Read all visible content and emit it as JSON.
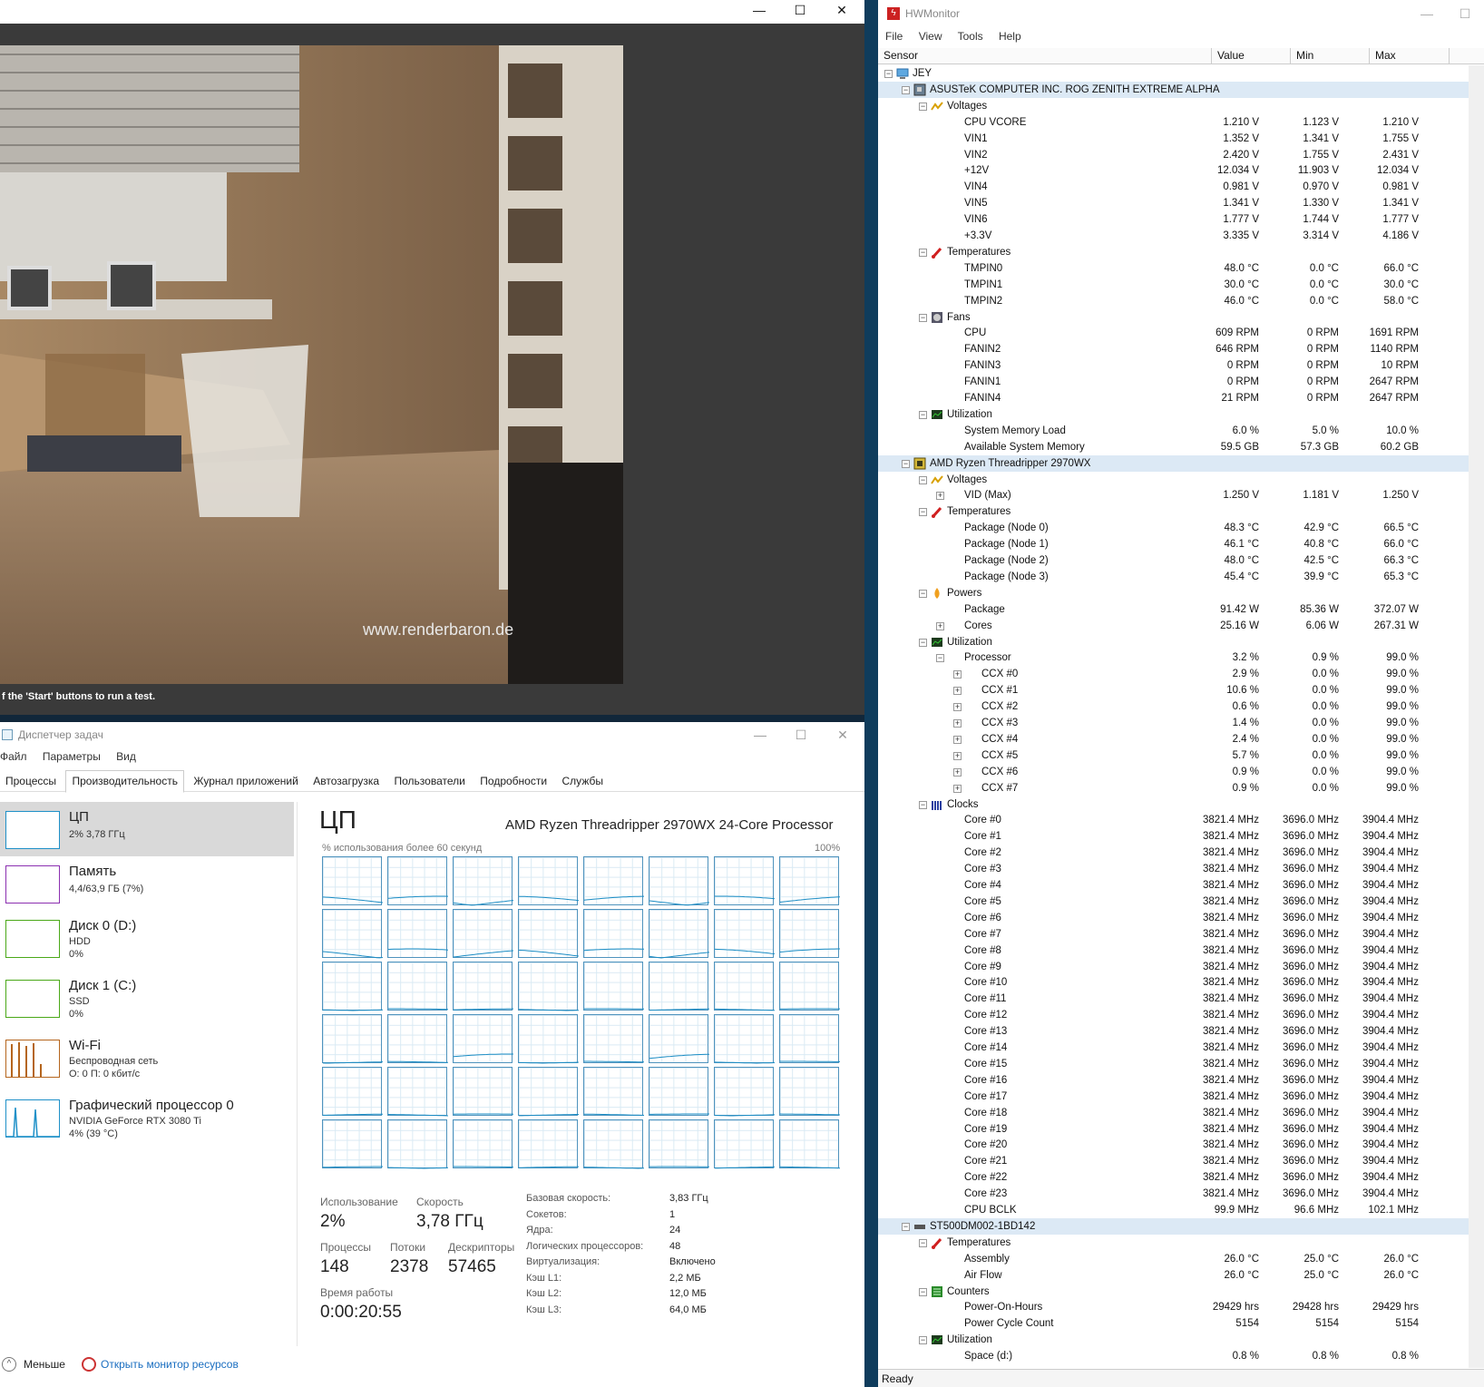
{
  "render_window": {
    "minimize": "—",
    "maximize": "☐",
    "close": "✕",
    "status": "f the 'Start' buttons to run a test.",
    "watermark": "www.renderbaron.de"
  },
  "task_manager": {
    "title": "Диспетчер задач",
    "menu": [
      "Файл",
      "Параметры",
      "Вид"
    ],
    "tabs": [
      "Процессы",
      "Производительность",
      "Журнал приложений",
      "Автозагрузка",
      "Пользователи",
      "Подробности",
      "Службы"
    ],
    "active_tab": 1,
    "sidebar": [
      {
        "title": "ЦП",
        "sub1": "2% 3,78 ГГц",
        "sub2": "",
        "color": "#1e90c8"
      },
      {
        "title": "Память",
        "sub1": "4,4/63,9 ГБ (7%)",
        "sub2": "",
        "color": "#8b2fb0"
      },
      {
        "title": "Диск 0 (D:)",
        "sub1": "HDD",
        "sub2": "0%",
        "color": "#4aa818"
      },
      {
        "title": "Диск 1 (C:)",
        "sub1": "SSD",
        "sub2": "0%",
        "color": "#4aa818"
      },
      {
        "title": "Wi-Fi",
        "sub1": "Беспроводная сеть",
        "sub2": "О: 0 П: 0 кбит/с",
        "color": "#b5651d"
      },
      {
        "title": "Графический процессор 0",
        "sub1": "NVIDIA GeForce RTX 3080 Ti",
        "sub2": "4% (39 °C)",
        "color": "#1e90c8"
      }
    ],
    "main": {
      "title": "ЦП",
      "processor": "AMD Ryzen Threadripper 2970WX 24-Core Processor",
      "graph_label": "% использования более 60 секунд",
      "graph_max": "100%",
      "usage_label": "Использование",
      "usage": "2%",
      "speed_label": "Скорость",
      "speed": "3,78 ГГц",
      "proc_label": "Процессы",
      "proc": "148",
      "threads_label": "Потоки",
      "threads": "2378",
      "handles_label": "Дескрипторы",
      "handles": "57465",
      "uptime_label": "Время работы",
      "uptime": "0:00:20:55",
      "info": [
        [
          "Базовая скорость:",
          "3,83 ГГц"
        ],
        [
          "Сокетов:",
          "1"
        ],
        [
          "Ядра:",
          "24"
        ],
        [
          "Логических процессоров:",
          "48"
        ],
        [
          "Виртуализация:",
          "Включено"
        ],
        [
          "Кэш L1:",
          "2,2 МБ"
        ],
        [
          "Кэш L2:",
          "12,0 МБ"
        ],
        [
          "Кэш L3:",
          "64,0 МБ"
        ]
      ]
    },
    "footer_less": "Меньше",
    "footer_link": "Открыть монитор ресурсов"
  },
  "hwmonitor": {
    "title": "HWMonitor",
    "menu": [
      "File",
      "View",
      "Tools",
      "Help"
    ],
    "columns": [
      "Sensor",
      "Value",
      "Min",
      "Max"
    ],
    "status": "Ready",
    "rows": [
      {
        "d": 0,
        "t": "JEY",
        "i": "pc"
      },
      {
        "d": 1,
        "t": "ASUSTeK COMPUTER INC. ROG ZENITH EXTREME ALPHA",
        "i": "mb",
        "hl": true
      },
      {
        "d": 2,
        "t": "Voltages",
        "i": "volt"
      },
      {
        "d": 3,
        "t": "CPU VCORE",
        "v": [
          "1.210 V",
          "1.123 V",
          "1.210 V"
        ]
      },
      {
        "d": 3,
        "t": "VIN1",
        "v": [
          "1.352 V",
          "1.341 V",
          "1.755 V"
        ]
      },
      {
        "d": 3,
        "t": "VIN2",
        "v": [
          "2.420 V",
          "1.755 V",
          "2.431 V"
        ]
      },
      {
        "d": 3,
        "t": "+12V",
        "v": [
          "12.034 V",
          "11.903 V",
          "12.034 V"
        ]
      },
      {
        "d": 3,
        "t": "VIN4",
        "v": [
          "0.981 V",
          "0.970 V",
          "0.981 V"
        ]
      },
      {
        "d": 3,
        "t": "VIN5",
        "v": [
          "1.341 V",
          "1.330 V",
          "1.341 V"
        ]
      },
      {
        "d": 3,
        "t": "VIN6",
        "v": [
          "1.777 V",
          "1.744 V",
          "1.777 V"
        ]
      },
      {
        "d": 3,
        "t": "+3.3V",
        "v": [
          "3.335 V",
          "3.314 V",
          "4.186 V"
        ]
      },
      {
        "d": 2,
        "t": "Temperatures",
        "i": "temp"
      },
      {
        "d": 3,
        "t": "TMPIN0",
        "v": [
          "48.0 °C",
          "0.0 °C",
          "66.0 °C"
        ]
      },
      {
        "d": 3,
        "t": "TMPIN1",
        "v": [
          "30.0 °C",
          "0.0 °C",
          "30.0 °C"
        ]
      },
      {
        "d": 3,
        "t": "TMPIN2",
        "v": [
          "46.0 °C",
          "0.0 °C",
          "58.0 °C"
        ]
      },
      {
        "d": 2,
        "t": "Fans",
        "i": "fan"
      },
      {
        "d": 3,
        "t": "CPU",
        "v": [
          "609 RPM",
          "0 RPM",
          "1691 RPM"
        ]
      },
      {
        "d": 3,
        "t": "FANIN2",
        "v": [
          "646 RPM",
          "0 RPM",
          "1140 RPM"
        ]
      },
      {
        "d": 3,
        "t": "FANIN3",
        "v": [
          "0 RPM",
          "0 RPM",
          "10 RPM"
        ]
      },
      {
        "d": 3,
        "t": "FANIN1",
        "v": [
          "0 RPM",
          "0 RPM",
          "2647 RPM"
        ]
      },
      {
        "d": 3,
        "t": "FANIN4",
        "v": [
          "21 RPM",
          "0 RPM",
          "2647 RPM"
        ]
      },
      {
        "d": 2,
        "t": "Utilization",
        "i": "util"
      },
      {
        "d": 3,
        "t": "System Memory Load",
        "v": [
          "6.0 %",
          "5.0 %",
          "10.0 %"
        ]
      },
      {
        "d": 3,
        "t": "Available System Memory",
        "v": [
          "59.5 GB",
          "57.3 GB",
          "60.2 GB"
        ]
      },
      {
        "d": 1,
        "t": "AMD Ryzen Threadripper 2970WX",
        "i": "cpu",
        "hl": true
      },
      {
        "d": 2,
        "t": "Voltages",
        "i": "volt"
      },
      {
        "d": 3,
        "t": "VID (Max)",
        "v": [
          "1.250 V",
          "1.181 V",
          "1.250 V"
        ],
        "plus": true
      },
      {
        "d": 2,
        "t": "Temperatures",
        "i": "temp"
      },
      {
        "d": 3,
        "t": "Package (Node 0)",
        "v": [
          "48.3 °C",
          "42.9 °C",
          "66.5 °C"
        ]
      },
      {
        "d": 3,
        "t": "Package (Node 1)",
        "v": [
          "46.1 °C",
          "40.8 °C",
          "66.0 °C"
        ]
      },
      {
        "d": 3,
        "t": "Package (Node 2)",
        "v": [
          "48.0 °C",
          "42.5 °C",
          "66.3 °C"
        ]
      },
      {
        "d": 3,
        "t": "Package (Node 3)",
        "v": [
          "45.4 °C",
          "39.9 °C",
          "65.3 °C"
        ]
      },
      {
        "d": 2,
        "t": "Powers",
        "i": "power"
      },
      {
        "d": 3,
        "t": "Package",
        "v": [
          "91.42 W",
          "85.36 W",
          "372.07 W"
        ]
      },
      {
        "d": 3,
        "t": "Cores",
        "v": [
          "25.16 W",
          "6.06 W",
          "267.31 W"
        ],
        "plus": true
      },
      {
        "d": 2,
        "t": "Utilization",
        "i": "util"
      },
      {
        "d": 3,
        "t": "Processor",
        "v": [
          "3.2 %",
          "0.9 %",
          "99.0 %"
        ],
        "minus": true
      },
      {
        "d": 4,
        "t": "CCX #0",
        "v": [
          "2.9 %",
          "0.0 %",
          "99.0 %"
        ],
        "plus": true
      },
      {
        "d": 4,
        "t": "CCX #1",
        "v": [
          "10.6 %",
          "0.0 %",
          "99.0 %"
        ],
        "plus": true
      },
      {
        "d": 4,
        "t": "CCX #2",
        "v": [
          "0.6 %",
          "0.0 %",
          "99.0 %"
        ],
        "plus": true
      },
      {
        "d": 4,
        "t": "CCX #3",
        "v": [
          "1.4 %",
          "0.0 %",
          "99.0 %"
        ],
        "plus": true
      },
      {
        "d": 4,
        "t": "CCX #4",
        "v": [
          "2.4 %",
          "0.0 %",
          "99.0 %"
        ],
        "plus": true
      },
      {
        "d": 4,
        "t": "CCX #5",
        "v": [
          "5.7 %",
          "0.0 %",
          "99.0 %"
        ],
        "plus": true
      },
      {
        "d": 4,
        "t": "CCX #6",
        "v": [
          "0.9 %",
          "0.0 %",
          "99.0 %"
        ],
        "plus": true
      },
      {
        "d": 4,
        "t": "CCX #7",
        "v": [
          "0.9 %",
          "0.0 %",
          "99.0 %"
        ],
        "plus": true
      },
      {
        "d": 2,
        "t": "Clocks",
        "i": "clock"
      },
      {
        "d": 3,
        "t": "Core #0",
        "v": [
          "3821.4 MHz",
          "3696.0 MHz",
          "3904.4 MHz"
        ]
      },
      {
        "d": 3,
        "t": "Core #1",
        "v": [
          "3821.4 MHz",
          "3696.0 MHz",
          "3904.4 MHz"
        ]
      },
      {
        "d": 3,
        "t": "Core #2",
        "v": [
          "3821.4 MHz",
          "3696.0 MHz",
          "3904.4 MHz"
        ]
      },
      {
        "d": 3,
        "t": "Core #3",
        "v": [
          "3821.4 MHz",
          "3696.0 MHz",
          "3904.4 MHz"
        ]
      },
      {
        "d": 3,
        "t": "Core #4",
        "v": [
          "3821.4 MHz",
          "3696.0 MHz",
          "3904.4 MHz"
        ]
      },
      {
        "d": 3,
        "t": "Core #5",
        "v": [
          "3821.4 MHz",
          "3696.0 MHz",
          "3904.4 MHz"
        ]
      },
      {
        "d": 3,
        "t": "Core #6",
        "v": [
          "3821.4 MHz",
          "3696.0 MHz",
          "3904.4 MHz"
        ]
      },
      {
        "d": 3,
        "t": "Core #7",
        "v": [
          "3821.4 MHz",
          "3696.0 MHz",
          "3904.4 MHz"
        ]
      },
      {
        "d": 3,
        "t": "Core #8",
        "v": [
          "3821.4 MHz",
          "3696.0 MHz",
          "3904.4 MHz"
        ]
      },
      {
        "d": 3,
        "t": "Core #9",
        "v": [
          "3821.4 MHz",
          "3696.0 MHz",
          "3904.4 MHz"
        ]
      },
      {
        "d": 3,
        "t": "Core #10",
        "v": [
          "3821.4 MHz",
          "3696.0 MHz",
          "3904.4 MHz"
        ]
      },
      {
        "d": 3,
        "t": "Core #11",
        "v": [
          "3821.4 MHz",
          "3696.0 MHz",
          "3904.4 MHz"
        ]
      },
      {
        "d": 3,
        "t": "Core #12",
        "v": [
          "3821.4 MHz",
          "3696.0 MHz",
          "3904.4 MHz"
        ]
      },
      {
        "d": 3,
        "t": "Core #13",
        "v": [
          "3821.4 MHz",
          "3696.0 MHz",
          "3904.4 MHz"
        ]
      },
      {
        "d": 3,
        "t": "Core #14",
        "v": [
          "3821.4 MHz",
          "3696.0 MHz",
          "3904.4 MHz"
        ]
      },
      {
        "d": 3,
        "t": "Core #15",
        "v": [
          "3821.4 MHz",
          "3696.0 MHz",
          "3904.4 MHz"
        ]
      },
      {
        "d": 3,
        "t": "Core #16",
        "v": [
          "3821.4 MHz",
          "3696.0 MHz",
          "3904.4 MHz"
        ]
      },
      {
        "d": 3,
        "t": "Core #17",
        "v": [
          "3821.4 MHz",
          "3696.0 MHz",
          "3904.4 MHz"
        ]
      },
      {
        "d": 3,
        "t": "Core #18",
        "v": [
          "3821.4 MHz",
          "3696.0 MHz",
          "3904.4 MHz"
        ]
      },
      {
        "d": 3,
        "t": "Core #19",
        "v": [
          "3821.4 MHz",
          "3696.0 MHz",
          "3904.4 MHz"
        ]
      },
      {
        "d": 3,
        "t": "Core #20",
        "v": [
          "3821.4 MHz",
          "3696.0 MHz",
          "3904.4 MHz"
        ]
      },
      {
        "d": 3,
        "t": "Core #21",
        "v": [
          "3821.4 MHz",
          "3696.0 MHz",
          "3904.4 MHz"
        ]
      },
      {
        "d": 3,
        "t": "Core #22",
        "v": [
          "3821.4 MHz",
          "3696.0 MHz",
          "3904.4 MHz"
        ]
      },
      {
        "d": 3,
        "t": "Core #23",
        "v": [
          "3821.4 MHz",
          "3696.0 MHz",
          "3904.4 MHz"
        ]
      },
      {
        "d": 3,
        "t": "CPU BCLK",
        "v": [
          "99.9 MHz",
          "96.6 MHz",
          "102.1 MHz"
        ]
      },
      {
        "d": 1,
        "t": "ST500DM002-1BD142",
        "i": "hdd",
        "hl": true
      },
      {
        "d": 2,
        "t": "Temperatures",
        "i": "temp"
      },
      {
        "d": 3,
        "t": "Assembly",
        "v": [
          "26.0 °C",
          "25.0 °C",
          "26.0 °C"
        ]
      },
      {
        "d": 3,
        "t": "Air Flow",
        "v": [
          "26.0 °C",
          "25.0 °C",
          "26.0 °C"
        ]
      },
      {
        "d": 2,
        "t": "Counters",
        "i": "counter"
      },
      {
        "d": 3,
        "t": "Power-On-Hours",
        "v": [
          "29429 hrs",
          "29428 hrs",
          "29429 hrs"
        ]
      },
      {
        "d": 3,
        "t": "Power Cycle Count",
        "v": [
          "5154",
          "5154",
          "5154"
        ]
      },
      {
        "d": 2,
        "t": "Utilization",
        "i": "util"
      },
      {
        "d": 3,
        "t": "Space (d:)",
        "v": [
          "0.8 %",
          "0.8 %",
          "0.8 %"
        ]
      }
    ]
  }
}
